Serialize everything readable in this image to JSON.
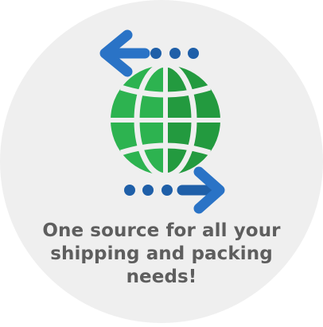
{
  "badge": {
    "tagline_lines": [
      "One source for all your",
      "shipping and packing",
      "needs!"
    ],
    "icons": {
      "top_arrow": "arrow-left-icon",
      "globe": "globe-icon",
      "bottom_arrow": "arrow-right-icon"
    },
    "colors": {
      "background_circle": "#efefef",
      "globe_green_light": "#2db350",
      "globe_green_dark": "#239a3f",
      "arrow_blue_light": "#2a73c6",
      "arrow_blue_dark": "#1f5fa8",
      "text_gray": "#5e5e5e"
    }
  }
}
